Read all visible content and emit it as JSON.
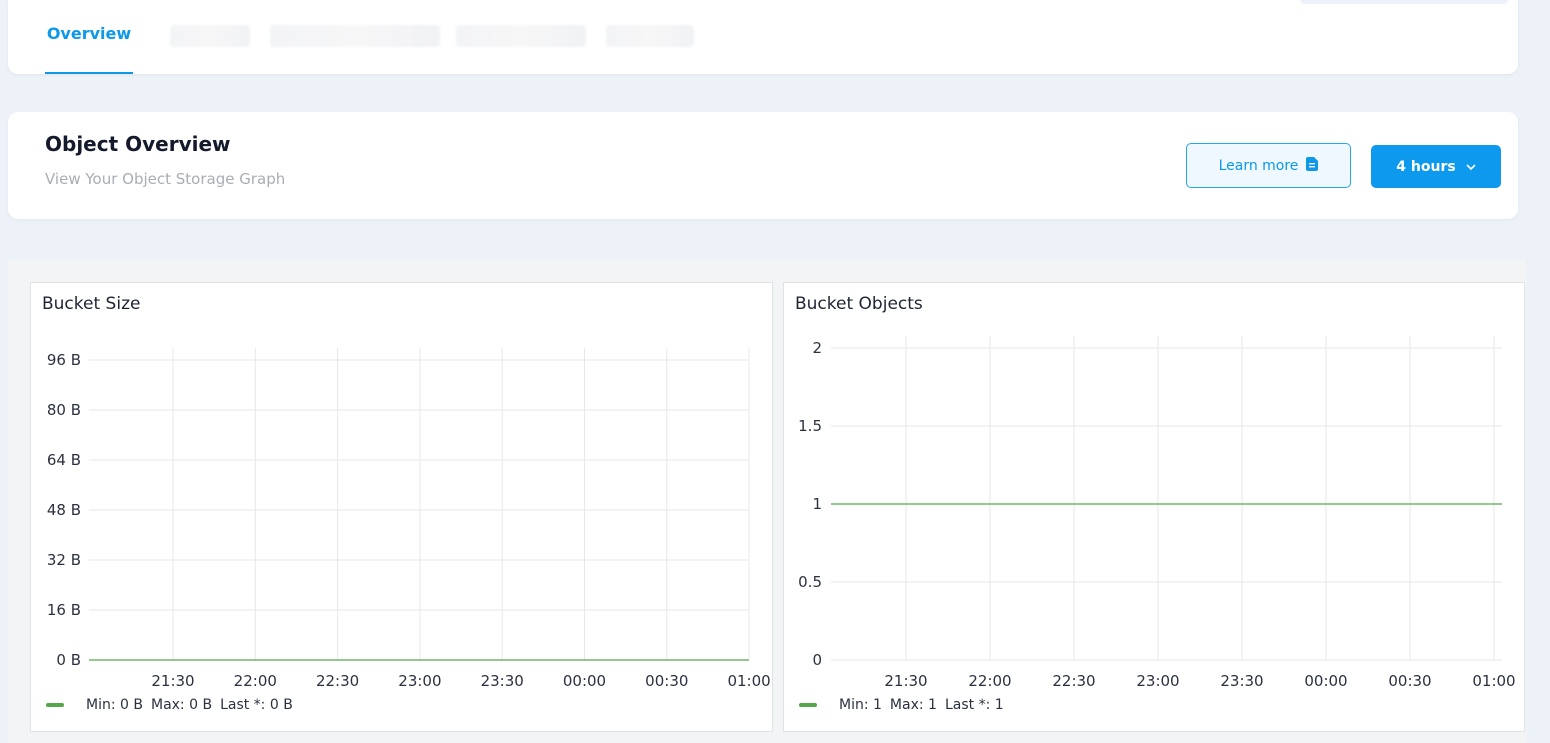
{
  "tabs": {
    "active_label": "Overview"
  },
  "overview": {
    "title": "Object Overview",
    "subtitle": "View Your Object Storage Graph",
    "learn_more_label": "Learn more",
    "learn_more_icon": "document-icon",
    "time_range_label": "4 hours",
    "time_range_icon": "chevron-down-icon"
  },
  "colors": {
    "accent": "#0d99ed",
    "series": "#56a64b"
  },
  "chart_data": [
    {
      "type": "line",
      "title": "Bucket Size",
      "x": [
        "21:30",
        "22:00",
        "22:30",
        "23:00",
        "23:30",
        "00:00",
        "00:30",
        "01:00"
      ],
      "y_ticks": [
        "0 B",
        "16 B",
        "32 B",
        "48 B",
        "64 B",
        "80 B",
        "96 B"
      ],
      "ylim": [
        0,
        96
      ],
      "series": [
        {
          "values": [
            0,
            0,
            0,
            0,
            0,
            0,
            0,
            0
          ]
        }
      ],
      "legend": {
        "min": "Min: 0 B",
        "max": "Max: 0 B",
        "last": "Last *: 0 B"
      },
      "grid": true
    },
    {
      "type": "line",
      "title": "Bucket Objects",
      "x": [
        "21:30",
        "22:00",
        "22:30",
        "23:00",
        "23:30",
        "00:00",
        "00:30",
        "01:00"
      ],
      "y_ticks": [
        "0",
        "0.5",
        "1",
        "1.5",
        "2"
      ],
      "ylim": [
        0,
        2
      ],
      "series": [
        {
          "values": [
            1,
            1,
            1,
            1,
            1,
            1,
            1,
            1
          ]
        }
      ],
      "legend": {
        "min": "Min: 1",
        "max": "Max: 1",
        "last": "Last *: 1"
      },
      "grid": true
    }
  ]
}
